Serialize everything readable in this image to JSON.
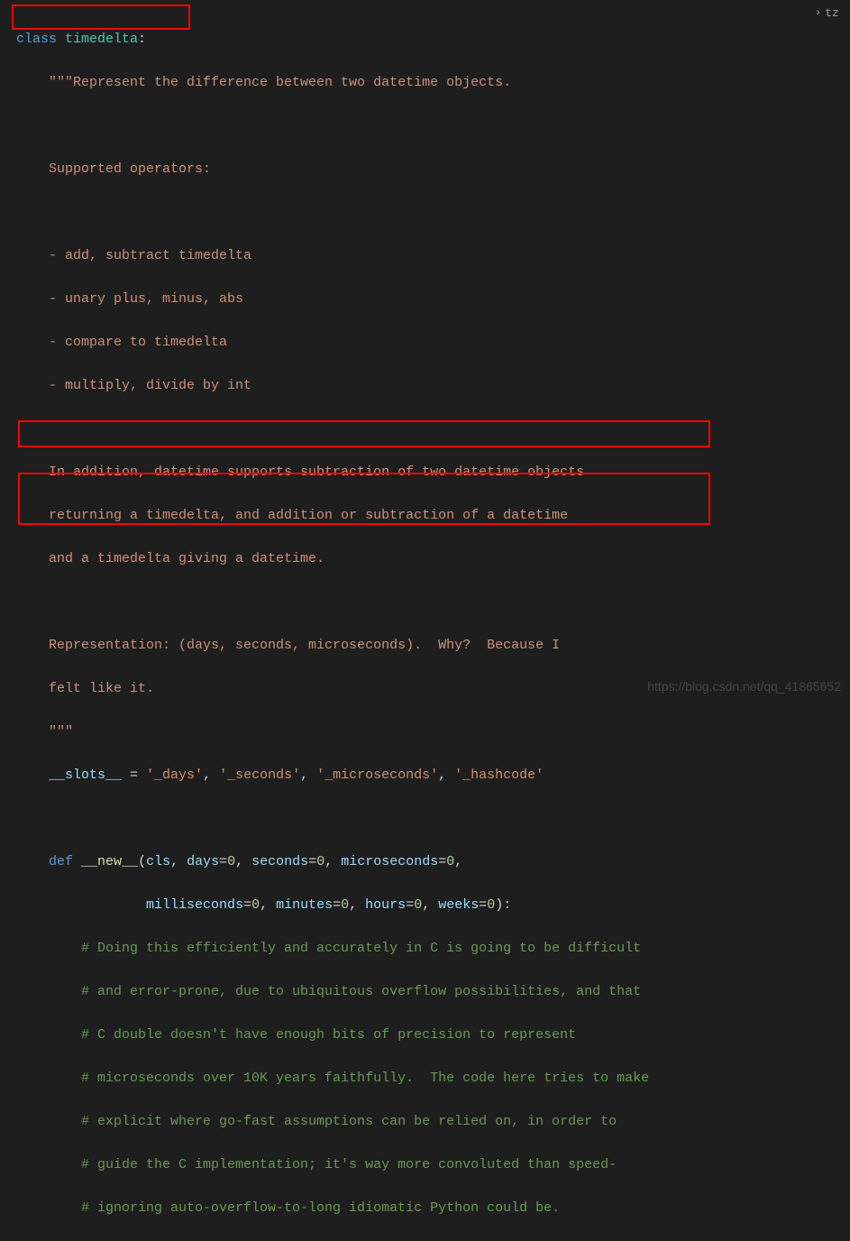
{
  "breadcrumb": {
    "label": "tz"
  },
  "code": {
    "l1_kw": "class",
    "l1_cls": "timedelta",
    "l1_colon": ":",
    "l2": "    \"\"\"Represent the difference between two datetime objects.",
    "l3": "",
    "l4": "    Supported operators:",
    "l5": "",
    "l6": "    - add, subtract timedelta",
    "l7": "    - unary plus, minus, abs",
    "l8": "    - compare to timedelta",
    "l9": "    - multiply, divide by int",
    "l10": "",
    "l11": "    In addition, datetime supports subtraction of two datetime objects",
    "l12": "    returning a timedelta, and addition or subtraction of a datetime",
    "l13": "    and a timedelta giving a datetime.",
    "l14": "",
    "l15": "    Representation: (days, seconds, microseconds).  Why?  Because I",
    "l16": "    felt like it.",
    "l17": "    \"\"\"",
    "l18_var": "    __slots__",
    "l18_eq": " = ",
    "l18_s1": "'_days'",
    "l18_c1": ", ",
    "l18_s2": "'_seconds'",
    "l18_c2": ", ",
    "l18_s3": "'_microseconds'",
    "l18_c3": ", ",
    "l18_s4": "'_hashcode'",
    "l19": "",
    "l20_ind": "    ",
    "l20_kw": "def",
    "l20_sp": " ",
    "l20_fn": "__new__",
    "l20_op": "(",
    "l20_p1": "cls",
    "l20_c1": ", ",
    "l20_p2": "days",
    "l20_e2": "=",
    "l20_v2": "0",
    "l20_c2": ", ",
    "l20_p3": "seconds",
    "l20_e3": "=",
    "l20_v3": "0",
    "l20_c3": ", ",
    "l20_p4": "microseconds",
    "l20_e4": "=",
    "l20_v4": "0",
    "l20_c4": ",",
    "l21_ind": "                ",
    "l21_p1": "milliseconds",
    "l21_e1": "=",
    "l21_v1": "0",
    "l21_c1": ", ",
    "l21_p2": "minutes",
    "l21_e2": "=",
    "l21_v2": "0",
    "l21_c2": ", ",
    "l21_p3": "hours",
    "l21_e3": "=",
    "l21_v3": "0",
    "l21_c3": ", ",
    "l21_p4": "weeks",
    "l21_e4": "=",
    "l21_v4": "0",
    "l21_cp": "):",
    "l22": "        # Doing this efficiently and accurately in C is going to be difficult",
    "l23": "        # and error-prone, due to ubiquitous overflow possibilities, and that",
    "l24": "        # C double doesn't have enough bits of precision to represent",
    "l25": "        # microseconds over 10K years faithfully.  The code here tries to make",
    "l26": "        # explicit where go-fast assumptions can be relied on, in order to",
    "l27": "        # guide the C implementation; it's way more convoluted than speed-",
    "l28": "        # ignoring auto-overflow-to-long idiomatic Python could be."
  },
  "watermark": "https://blog.csdn.net/qq_41865652"
}
